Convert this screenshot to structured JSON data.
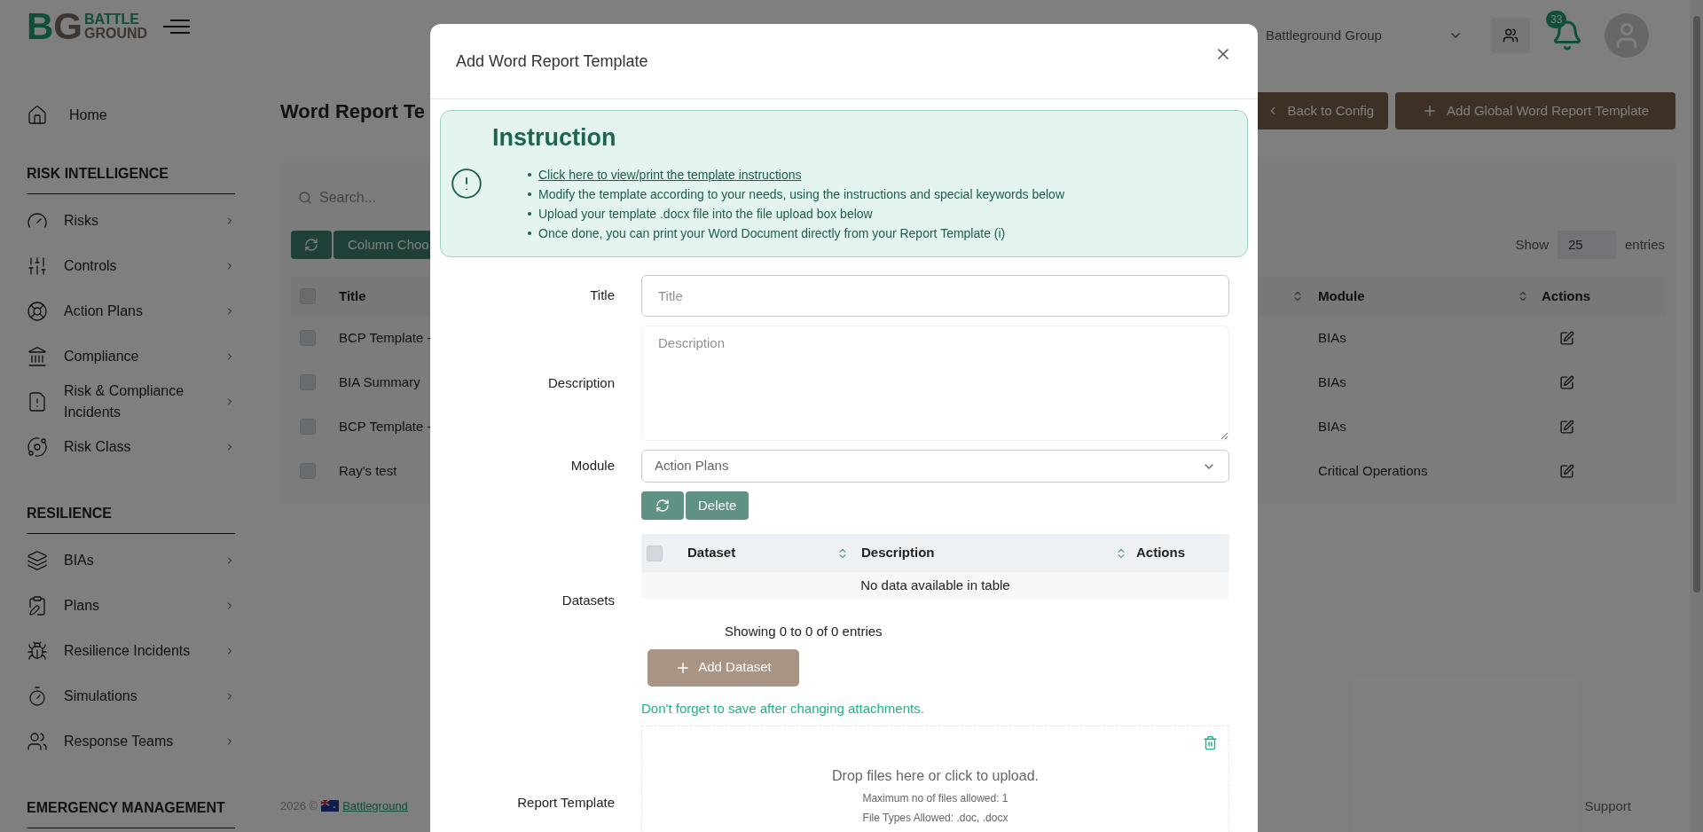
{
  "logo": {
    "mark_left": "B",
    "mark_right": "G",
    "name_top": "BATTLE",
    "name_bottom": "GROUND"
  },
  "topbar": {
    "organization": "Battleground Group",
    "notification_count": "33"
  },
  "sidebar": {
    "home": "Home",
    "sections": [
      {
        "heading": "RISK INTELLIGENCE",
        "items": [
          "Risks",
          "Controls",
          "Action Plans",
          "Compliance",
          "Risk & Compliance Incidents",
          "Risk Class"
        ]
      },
      {
        "heading": "RESILIENCE",
        "items": [
          "BIAs",
          "Plans",
          "Resilience Incidents",
          "Simulations",
          "Response Teams"
        ]
      },
      {
        "heading": "EMERGENCY MANAGEMENT"
      }
    ]
  },
  "page": {
    "title": "Word Report Te",
    "back_button": "Back to Config",
    "add_button": "Add Global Word Report Template",
    "search_placeholder": "Search...",
    "column_chooser": "Column Choo",
    "show_label": "Show",
    "page_size": "25",
    "entries_label": "entries",
    "table": {
      "select_all_checked": false,
      "columns": [
        "Title",
        "Module",
        "Actions"
      ],
      "rows": [
        {
          "title": "BCP Template -",
          "module": "BIAs",
          "checked": false
        },
        {
          "title": "BIA Summary",
          "module": "BIAs",
          "checked": false
        },
        {
          "title": "BCP Template -",
          "module": "BIAs",
          "checked": false
        },
        {
          "title": "Ray's test",
          "module": "Critical Operations",
          "checked": false
        }
      ]
    },
    "footer": {
      "copyright": "2026 ©",
      "company_link": "Battleground",
      "support": "Support"
    }
  },
  "modal": {
    "title": "Add Word Report Template",
    "instruction": {
      "heading": "Instruction",
      "items": [
        {
          "kind": "link",
          "text": "Click here to view/print the template instructions"
        },
        {
          "kind": "text",
          "text": "Modify the template according to your needs, using the instructions and special keywords below"
        },
        {
          "kind": "text",
          "text": "Upload your template .docx file into the file upload box below"
        },
        {
          "kind": "text",
          "text": "Once done, you can print your Word Document directly from your Report Template (i)"
        }
      ]
    },
    "title_label": "Title",
    "title_placeholder": "Title",
    "description_label": "Description",
    "description_placeholder": "Description",
    "module_label": "Module",
    "module_value": "Action Plans",
    "delete_button": "Delete",
    "datasets": {
      "label": "Datasets",
      "select_all_checked": false,
      "columns": [
        "Dataset",
        "Description",
        "Actions"
      ],
      "empty": "No data available in table",
      "showing": "Showing 0 to 0 of 0 entries",
      "add_button": "Add Dataset"
    },
    "note": "Don't forget to save after changing attachments.",
    "report_template_label": "Report Template",
    "dropzone": {
      "main": "Drop files here or click to upload.",
      "max_files": "Maximum no of files allowed: 1",
      "file_types": "File Types Allowed: .doc, .docx"
    }
  }
}
